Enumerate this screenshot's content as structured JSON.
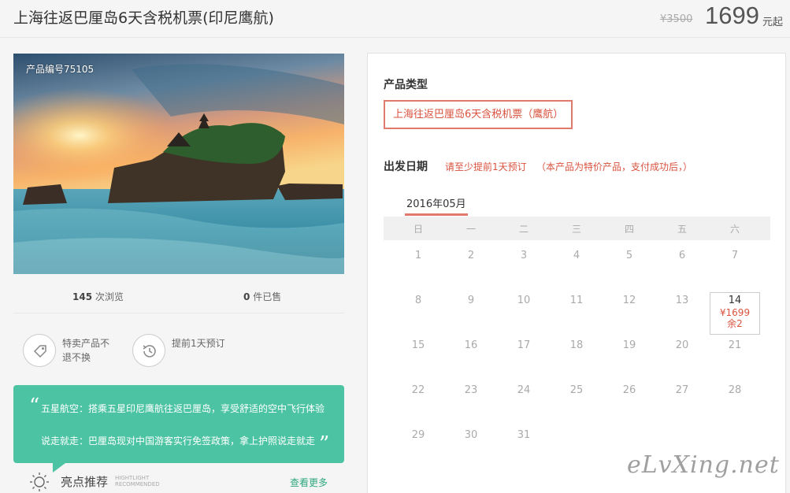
{
  "header": {
    "title": "上海往返巴厘岛6天含税机票(印尼鹰航)",
    "original_price": "¥3500",
    "price": "1699",
    "price_unit": "元起"
  },
  "product": {
    "number_label": "产品编号75105"
  },
  "stats": {
    "views_count": "145",
    "views_label": "次浏览",
    "sold_count": "0",
    "sold_label": "件已售"
  },
  "features": [
    {
      "icon": "tag-icon",
      "text": "特卖产品不退不换"
    },
    {
      "icon": "clock-history-icon",
      "text": "提前1天预订"
    }
  ],
  "highlight_box": {
    "line1": "五星航空：搭乘五星印尼鹰航往返巴厘岛，享受舒适的空中飞行体验",
    "line2": "说走就走：巴厘岛现对中国游客实行免签政策，拿上护照说走就走"
  },
  "highlights": {
    "title": "亮点推荐",
    "en_line1": "HIGHTLIGHT",
    "en_line2": "RECOMMENDED",
    "more": "查看更多"
  },
  "booking": {
    "product_type_label": "产品类型",
    "product_type_value": "上海往返巴厘岛6天含税机票（鹰航）",
    "departure_label": "出发日期",
    "note1": "请至少提前1天预订",
    "note2": "（本产品为特价产品，支付成功后，）",
    "month": "2016年05月",
    "weekdays": [
      "日",
      "一",
      "二",
      "三",
      "四",
      "五",
      "六"
    ],
    "weeks": [
      [
        "1",
        "2",
        "3",
        "4",
        "5",
        "6",
        "7"
      ],
      [
        "8",
        "9",
        "10",
        "11",
        "12",
        "13",
        "14"
      ],
      [
        "15",
        "16",
        "17",
        "18",
        "19",
        "20",
        "21"
      ],
      [
        "22",
        "23",
        "24",
        "25",
        "26",
        "27",
        "28"
      ],
      [
        "29",
        "30",
        "31"
      ]
    ],
    "selected": {
      "day": "14",
      "price": "¥1699",
      "remain": "余2"
    }
  },
  "watermark": "eLvXing.net",
  "colors": {
    "accent_red": "#d9533f",
    "highlight_green": "#4cc4a3",
    "link_green": "#2ea77f"
  }
}
